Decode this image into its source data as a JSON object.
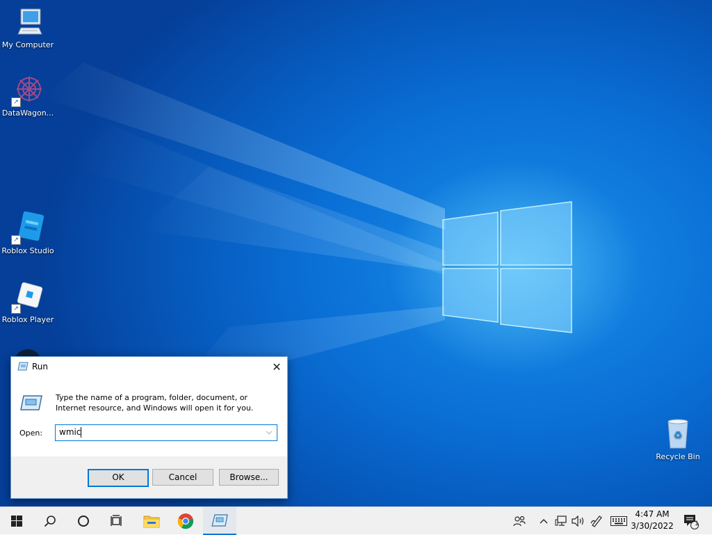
{
  "desktop": {
    "icons": [
      {
        "label": "My Computer",
        "icon": "computer-icon"
      },
      {
        "label": "DataWagon...",
        "icon": "datawagon-icon"
      },
      {
        "label": "Roblox Studio",
        "icon": "roblox-studio-icon"
      },
      {
        "label": "Roblox Player",
        "icon": "roblox-player-icon"
      },
      {
        "label": "Recycle Bin",
        "icon": "recycle-bin-icon"
      }
    ]
  },
  "run_dialog": {
    "title": "Run",
    "close_glyph": "✕",
    "description": "Type the name of a program, folder, document, or Internet resource, and Windows will open it for you.",
    "open_label": "Open:",
    "open_value": "wmic",
    "buttons": {
      "ok": "OK",
      "cancel": "Cancel",
      "browse": "Browse..."
    }
  },
  "taskbar": {
    "pinned": [
      "start-icon",
      "search-icon",
      "cortana-icon",
      "task-view-icon",
      "file-explorer-icon",
      "chrome-icon",
      "run-app-icon"
    ],
    "active_app": "run-app-icon",
    "clock": {
      "time": "4:47 AM",
      "date": "3/30/2022"
    },
    "notification_count": "1"
  },
  "colors": {
    "accent": "#0078d7",
    "desktop_blue": "#0a6fd6",
    "taskbar": "#f0f0f0"
  }
}
